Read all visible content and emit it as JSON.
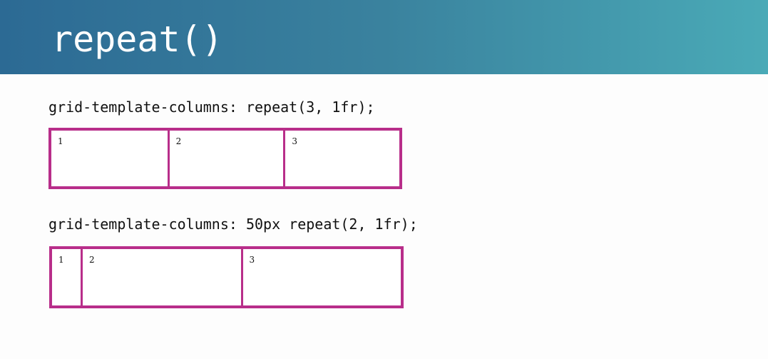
{
  "title": "repeat()",
  "examples": [
    {
      "code": "grid-template-columns: repeat(3, 1fr);",
      "cells": [
        "1",
        "2",
        "3"
      ]
    },
    {
      "code": "grid-template-columns: 50px repeat(2, 1fr);",
      "cells": [
        "1",
        "2",
        "3"
      ]
    }
  ],
  "colors": {
    "header_start": "#2c6a94",
    "header_end": "#4aaab7",
    "grid_border": "#b82e8a",
    "background": "#fdfdfd"
  }
}
